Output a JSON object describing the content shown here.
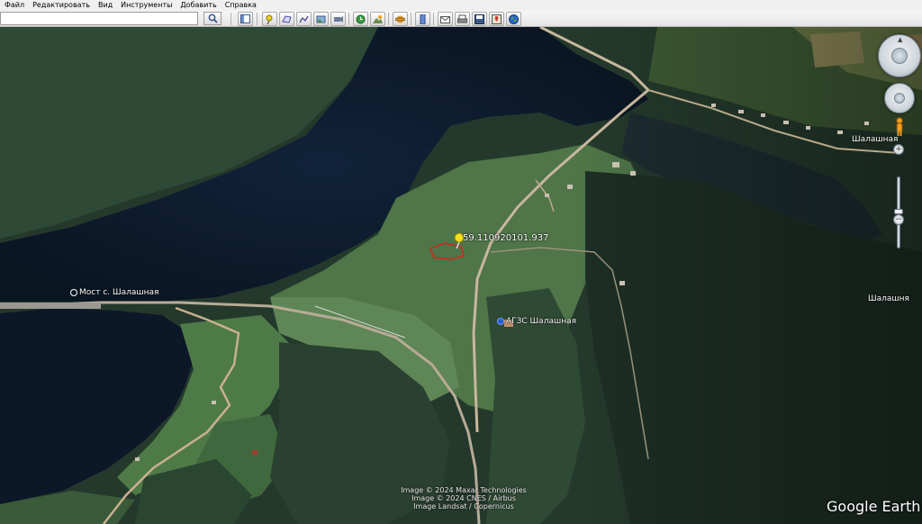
{
  "menu": {
    "items": [
      "Файл",
      "Редактировать",
      "Вид",
      "Инструменты",
      "Добавить",
      "Справка"
    ]
  },
  "toolbar": {
    "search_value": "",
    "buttons": [
      {
        "name": "sidebar-toggle",
        "icon": "sidebar-icon"
      },
      {
        "name": "add-placemark",
        "icon": "pushpin-icon"
      },
      {
        "name": "add-polygon",
        "icon": "polygon-icon"
      },
      {
        "name": "add-path",
        "icon": "path-icon"
      },
      {
        "name": "add-image-overlay",
        "icon": "overlay-icon"
      },
      {
        "name": "record-tour",
        "icon": "tour-icon"
      },
      {
        "name": "historical-imagery",
        "icon": "clock-icon"
      },
      {
        "name": "sunlight",
        "icon": "sun-icon"
      },
      {
        "name": "switch-to-sky",
        "icon": "planet-icon"
      },
      {
        "name": "ruler",
        "icon": "ruler-icon"
      },
      {
        "name": "email",
        "icon": "email-icon"
      },
      {
        "name": "print",
        "icon": "print-icon"
      },
      {
        "name": "save-image",
        "icon": "save-image-icon"
      },
      {
        "name": "view-in-maps",
        "icon": "maps-icon"
      },
      {
        "name": "earth",
        "icon": "earth-icon"
      }
    ]
  },
  "map": {
    "labels": {
      "bridge": "Мост с. Шалашная",
      "village_top": "Шалашная",
      "village_right": "Шалашня",
      "fuel_station": "АГЗС Шалашная"
    },
    "placemark_coords": "59.110920101.937",
    "attribution": {
      "line1": "Image © 2024 Maxar Technologies",
      "line2": "Image © 2024 CNES / Airbus",
      "line3": "Image Landsat / Copernicus"
    },
    "logo": "Google Earth"
  },
  "colors": {
    "water": "#0d1a2a",
    "forest": "#22382b",
    "meadow": "#5f8a58",
    "road": "#c8b79e",
    "placemark": "#f4e11b",
    "parcel_outline": "#d0281e"
  }
}
